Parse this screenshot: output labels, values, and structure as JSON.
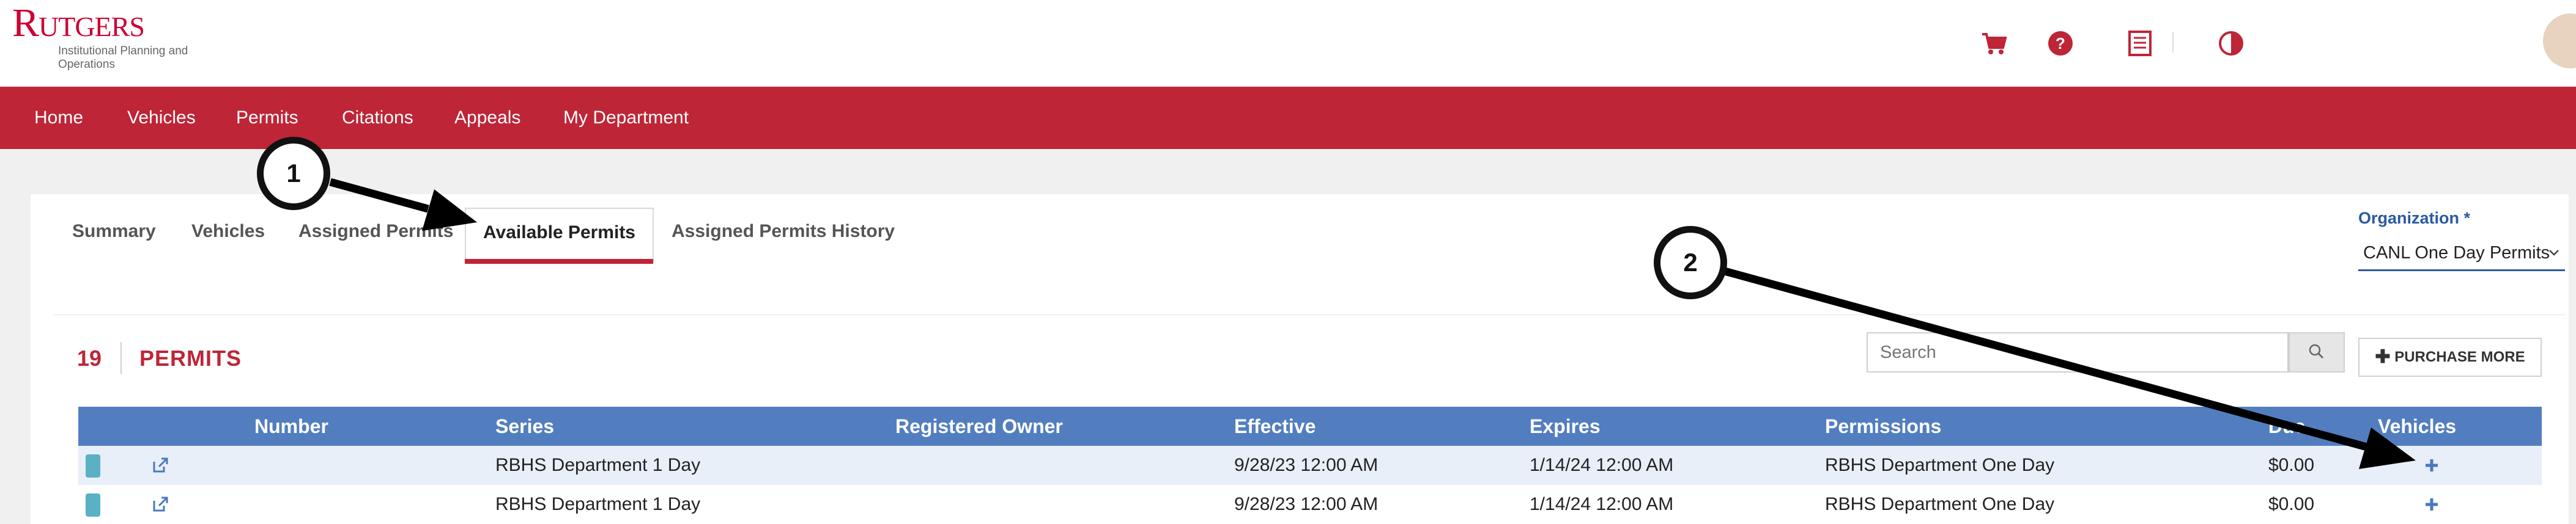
{
  "header": {
    "logo_text": "Rutgers",
    "logo_subtitle": "Institutional Planning and Operations",
    "icons": [
      "cart-icon",
      "help-icon",
      "receipt-icon",
      "contrast-icon"
    ]
  },
  "nav": {
    "items": [
      {
        "label": "Home"
      },
      {
        "label": "Vehicles"
      },
      {
        "label": "Permits"
      },
      {
        "label": "Citations"
      },
      {
        "label": "Appeals"
      },
      {
        "label": "My Department"
      }
    ]
  },
  "tabs": {
    "items": [
      {
        "label": "Summary"
      },
      {
        "label": "Vehicles"
      },
      {
        "label": "Assigned Permits"
      },
      {
        "label": "Available Permits",
        "active": true
      },
      {
        "label": "Assigned Permits History"
      }
    ]
  },
  "organization": {
    "label": "Organization *",
    "selected": "CANL One Day Permits"
  },
  "permits": {
    "count": "19",
    "title": "PERMITS",
    "search_placeholder": "Search",
    "purchase_label": "PURCHASE MORE"
  },
  "table": {
    "columns": [
      "Number",
      "Series",
      "Registered Owner",
      "Effective",
      "Expires",
      "Permissions",
      "Due",
      "Vehicles"
    ],
    "rows": [
      {
        "number": "",
        "series": "RBHS Department 1 Day",
        "owner": "",
        "effective": "9/28/23 12:00 AM",
        "expires": "1/14/24 12:00 AM",
        "permissions": "RBHS Department One Day",
        "due": "$0.00"
      },
      {
        "number": "",
        "series": "RBHS Department 1 Day",
        "owner": "",
        "effective": "9/28/23 12:00 AM",
        "expires": "1/14/24 12:00 AM",
        "permissions": "RBHS Department One Day",
        "due": "$0.00"
      }
    ]
  },
  "annotations": {
    "callout_1": "1",
    "callout_2": "2"
  },
  "colors": {
    "brand_red": "#be2537",
    "table_header_blue": "#527ec0",
    "link_blue": "#2c5aa0"
  }
}
